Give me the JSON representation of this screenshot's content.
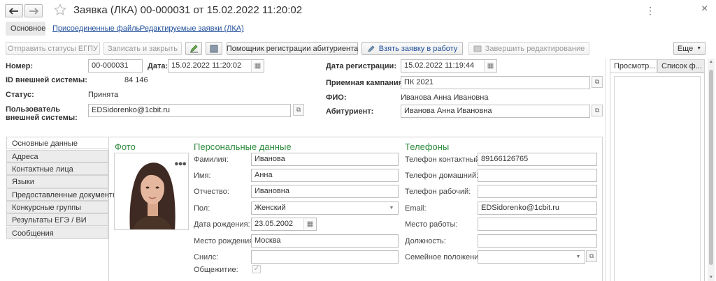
{
  "window": {
    "title": "Заявка (ЛКА) 00-000031 от 15.02.2022 11:20:02",
    "back_icon": "arrow-left",
    "forward_icon": "arrow-right",
    "star_icon": "star-outline",
    "menu_icon": "kebab",
    "close_icon": "close"
  },
  "page_tabs": [
    {
      "label": "Основное"
    },
    {
      "label": "Присоединенные файлы"
    },
    {
      "label": "Редактируемые заявки (ЛКА)"
    }
  ],
  "toolbar": {
    "send_status": "Отправить статусы ЕГПУ",
    "save_close": "Записать и закрыть",
    "helper": "Помощник регистрации абитуриента",
    "take_request": "Взять заявку в работу",
    "finish_edit": "Завершить редактирование",
    "more": "Еще"
  },
  "header": {
    "number_label": "Номер:",
    "number_value": "00-000031",
    "date_label": "Дата:",
    "date_value": "15.02.2022 11:20:02",
    "ext_id_label": "ID внешней системы:",
    "ext_id_value": "84 146",
    "status_label": "Статус:",
    "status_value": "Принята",
    "ext_user_label_1": "Пользователь",
    "ext_user_label_2": "внешней системы:",
    "ext_user_value": "EDSidorenko@1cbit.ru",
    "reg_date_label": "Дата регистрации:",
    "reg_date_value": "15.02.2022 11:19:44",
    "campaign_label": "Приемная кампания:",
    "campaign_value": "ПК 2021",
    "fio_label": "ФИО:",
    "fio_value": "Иванова Анна Ивановна",
    "applicant_label": "Абитуриент:",
    "applicant_value": "Иванова Анна Ивановна"
  },
  "side_tabs": [
    {
      "label": "Основные данные"
    },
    {
      "label": "Адреса"
    },
    {
      "label": "Контактные лица"
    },
    {
      "label": "Языки"
    },
    {
      "label": "Предоставленные документы"
    },
    {
      "label": "Конкурсные группы"
    },
    {
      "label": "Результаты ЕГЭ / ВИ"
    },
    {
      "label": "Сообщения"
    }
  ],
  "photo": {
    "title": "Фото"
  },
  "personal": {
    "title": "Персональные данные",
    "surname_label": "Фамилия:",
    "surname": "Иванова",
    "name_label": "Имя:",
    "name": "Анна",
    "patronymic_label": "Отчество:",
    "patronymic": "Ивановна",
    "sex_label": "Пол:",
    "sex": "Женский",
    "birthdate_label": "Дата рождения:",
    "birthdate": "23.05.2002",
    "birthplace_label": "Место рождения:",
    "birthplace": "Москва",
    "snils_label": "Снилс:",
    "snils": "",
    "dorm_label": "Общежитие:"
  },
  "phones": {
    "title": "Телефоны",
    "contact_label": "Телефон контактный:",
    "contact": "89166126765",
    "home_label": "Телефон домашний:",
    "home": "",
    "work_label": "Телефон рабочий:",
    "work": "",
    "email_label": "Email:",
    "email": "EDSidorenko@1cbit.ru",
    "workplace_label": "Место работы:",
    "workplace": "",
    "position_label": "Должность:",
    "position": "",
    "family_label": "Семейное положение:",
    "family": ""
  },
  "right_panel": {
    "tab1": "Просмотр...",
    "tab2": "Список ф..."
  }
}
